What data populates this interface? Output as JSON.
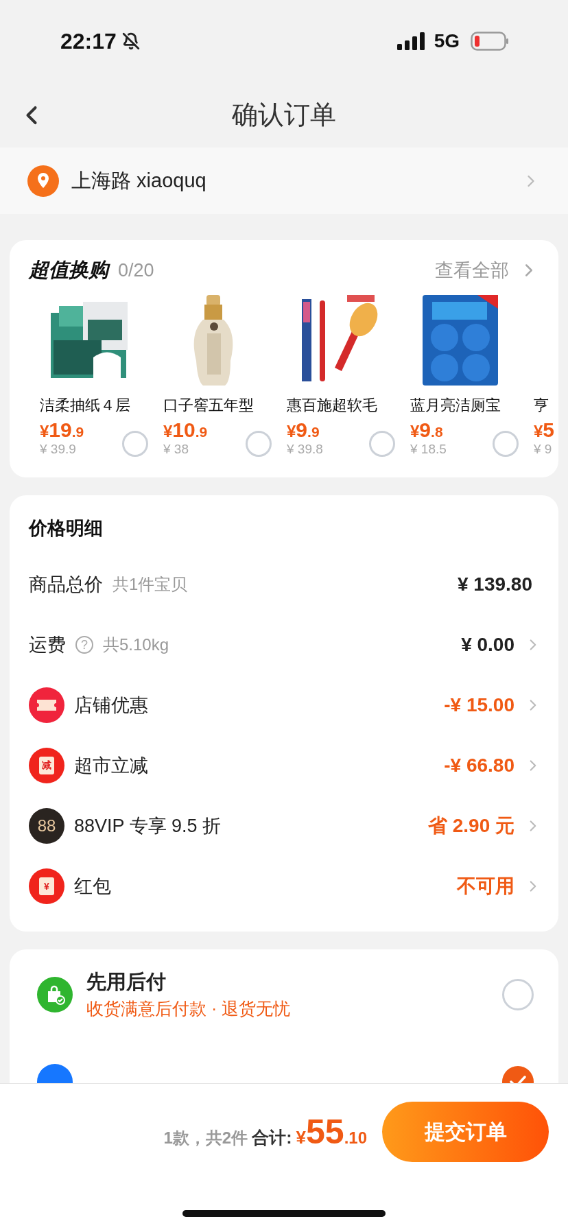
{
  "status_bar": {
    "time": "22:17",
    "network": "5G"
  },
  "nav": {
    "title": "确认订单"
  },
  "address": {
    "text": "上海路 xiaoquq"
  },
  "exchange": {
    "title": "超值换购",
    "count": "0/20",
    "view_all": "查看全部",
    "items": [
      {
        "kind": "full",
        "name": "洁柔抽纸４层",
        "currency": "¥",
        "price_int": "19",
        "price_dec": ".9",
        "original": "¥ 39.9",
        "selected": false
      },
      {
        "kind": "full",
        "name": "口子窖五年型",
        "currency": "¥",
        "price_int": "10",
        "price_dec": ".9",
        "original": "¥ 38",
        "selected": false
      },
      {
        "kind": "full",
        "name": "惠百施超软毛",
        "currency": "¥",
        "price_int": "9",
        "price_dec": ".9",
        "original": "¥ 39.8",
        "selected": false
      },
      {
        "kind": "full",
        "name": "蓝月亮洁厕宝",
        "currency": "¥",
        "price_int": "9",
        "price_dec": ".8",
        "original": "¥ 18.5",
        "selected": false
      },
      {
        "kind": "cut",
        "name": "亨",
        "currency": "¥",
        "price_int": "5",
        "original": "¥ 9"
      }
    ]
  },
  "price_detail": {
    "title": "价格明细",
    "rows": [
      {
        "kind": "plain",
        "label": "商品总价",
        "note": "共1件宝贝",
        "value": "¥ 139.80"
      },
      {
        "kind": "help",
        "label": "运费",
        "help_icon": "?",
        "note": "共5.10kg",
        "value": "¥ 0.00"
      },
      {
        "kind": "ticket",
        "label": "店铺优惠",
        "value": "-¥ 15.00"
      },
      {
        "kind": "envelope",
        "icon_text": "减",
        "label": "超市立减",
        "value": "-¥ 66.80"
      },
      {
        "kind": "vip",
        "icon_text": "88",
        "label": "88VIP 专享 9.5 折",
        "value": "省 2.90 元"
      },
      {
        "kind": "envelope",
        "icon_text": "¥",
        "label": "红包",
        "value": "不可用"
      }
    ]
  },
  "payment": [
    {
      "title": "先用后付",
      "subtitle": "收货满意后付款 · 退货无忧",
      "selected": false
    },
    {
      "selected": true
    }
  ],
  "footer": {
    "summary": "1款，共2件",
    "total_label": "合计:",
    "currency": "¥",
    "total_int": "55",
    "total_dec": ".10",
    "submit": "提交订单"
  }
}
